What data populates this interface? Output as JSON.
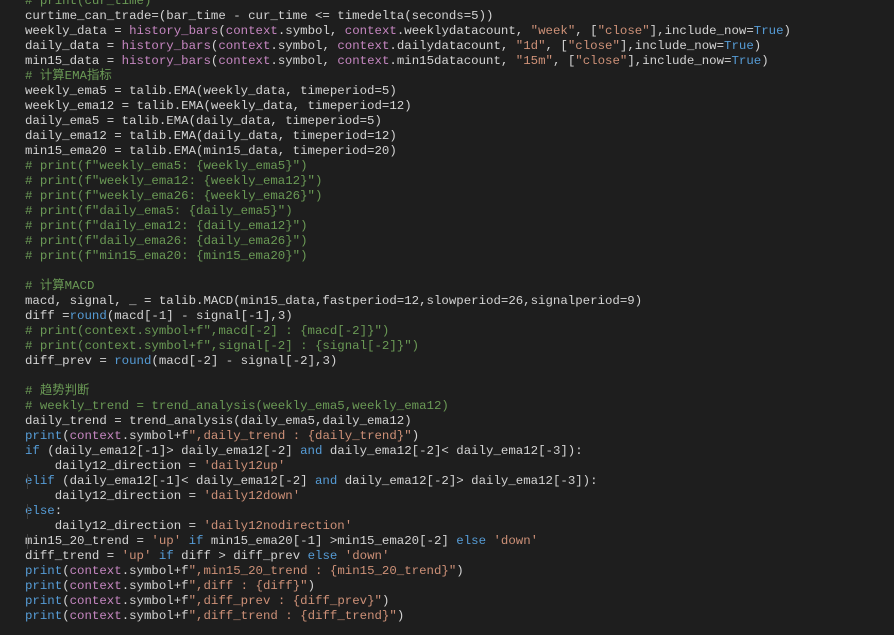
{
  "theme": {
    "background": "#1e1e1e",
    "text": "#d4d4d4",
    "comment": "#6a9955",
    "keyword": "#569cd6",
    "function": "#c586c0",
    "string": "#ce9178"
  },
  "lines": [
    [
      {
        "t": "cmt",
        "v": "# print(cur_time)"
      }
    ],
    [
      {
        "t": "txt",
        "v": "curtime_can_trade=(bar_time - cur_time <= timedelta(seconds=5))"
      }
    ],
    [
      {
        "t": "txt",
        "v": "weekly_data = "
      },
      {
        "t": "fn",
        "v": "history_bars"
      },
      {
        "t": "txt",
        "v": "("
      },
      {
        "t": "fn",
        "v": "context"
      },
      {
        "t": "txt",
        "v": ".symbol, "
      },
      {
        "t": "fn",
        "v": "context"
      },
      {
        "t": "txt",
        "v": ".weeklydatacount, "
      },
      {
        "t": "str",
        "v": "\"week\""
      },
      {
        "t": "txt",
        "v": ", ["
      },
      {
        "t": "str",
        "v": "\"close\""
      },
      {
        "t": "txt",
        "v": "],include_now="
      },
      {
        "t": "kw",
        "v": "True"
      },
      {
        "t": "txt",
        "v": ")"
      }
    ],
    [
      {
        "t": "txt",
        "v": "daily_data = "
      },
      {
        "t": "fn",
        "v": "history_bars"
      },
      {
        "t": "txt",
        "v": "("
      },
      {
        "t": "fn",
        "v": "context"
      },
      {
        "t": "txt",
        "v": ".symbol, "
      },
      {
        "t": "fn",
        "v": "context"
      },
      {
        "t": "txt",
        "v": ".dailydatacount, "
      },
      {
        "t": "str",
        "v": "\"1d\""
      },
      {
        "t": "txt",
        "v": ", ["
      },
      {
        "t": "str",
        "v": "\"close\""
      },
      {
        "t": "txt",
        "v": "],include_now="
      },
      {
        "t": "kw",
        "v": "True"
      },
      {
        "t": "txt",
        "v": ")"
      }
    ],
    [
      {
        "t": "txt",
        "v": "min15_data = "
      },
      {
        "t": "fn",
        "v": "history_bars"
      },
      {
        "t": "txt",
        "v": "("
      },
      {
        "t": "fn",
        "v": "context"
      },
      {
        "t": "txt",
        "v": ".symbol, "
      },
      {
        "t": "fn",
        "v": "context"
      },
      {
        "t": "txt",
        "v": ".min15datacount, "
      },
      {
        "t": "str",
        "v": "\"15m\""
      },
      {
        "t": "txt",
        "v": ", ["
      },
      {
        "t": "str",
        "v": "\"close\""
      },
      {
        "t": "txt",
        "v": "],include_now="
      },
      {
        "t": "kw",
        "v": "True"
      },
      {
        "t": "txt",
        "v": ")"
      }
    ],
    [
      {
        "t": "cmt",
        "v": "# 计算EMA指标"
      }
    ],
    [
      {
        "t": "txt",
        "v": "weekly_ema5 = talib.EMA(weekly_data, timeperiod=5)"
      }
    ],
    [
      {
        "t": "txt",
        "v": "weekly_ema12 = talib.EMA(weekly_data, timeperiod=12)"
      }
    ],
    [
      {
        "t": "txt",
        "v": "daily_ema5 = talib.EMA(daily_data, timeperiod=5)"
      }
    ],
    [
      {
        "t": "txt",
        "v": "daily_ema12 = talib.EMA(daily_data, timeperiod=12)"
      }
    ],
    [
      {
        "t": "txt",
        "v": "min15_ema20 = talib.EMA(min15_data, timeperiod=20)"
      }
    ],
    [
      {
        "t": "cmt",
        "v": "# print(f\"weekly_ema5: {weekly_ema5}\")"
      }
    ],
    [
      {
        "t": "cmt",
        "v": "# print(f\"weekly_ema12: {weekly_ema12}\")"
      }
    ],
    [
      {
        "t": "cmt",
        "v": "# print(f\"weekly_ema26: {weekly_ema26}\")"
      }
    ],
    [
      {
        "t": "cmt",
        "v": "# print(f\"daily_ema5: {daily_ema5}\")"
      }
    ],
    [
      {
        "t": "cmt",
        "v": "# print(f\"daily_ema12: {daily_ema12}\")"
      }
    ],
    [
      {
        "t": "cmt",
        "v": "# print(f\"daily_ema26: {daily_ema26}\")"
      }
    ],
    [
      {
        "t": "cmt",
        "v": "# print(f\"min15_ema20: {min15_ema20}\")"
      }
    ],
    [],
    [
      {
        "t": "cmt",
        "v": "# 计算MACD"
      }
    ],
    [
      {
        "t": "txt",
        "v": "macd, signal, _ = talib.MACD(min15_data,fastperiod=12,slowperiod=26,signalperiod=9)"
      }
    ],
    [
      {
        "t": "txt",
        "v": "diff ="
      },
      {
        "t": "kw",
        "v": "round"
      },
      {
        "t": "txt",
        "v": "(macd[-1] - signal[-1],3)"
      }
    ],
    [
      {
        "t": "cmt",
        "v": "# print(context.symbol+f\",macd[-2] : {macd[-2]}\")"
      }
    ],
    [
      {
        "t": "cmt",
        "v": "# print(context.symbol+f\",signal[-2] : {signal[-2]}\")"
      }
    ],
    [
      {
        "t": "txt",
        "v": "diff_prev = "
      },
      {
        "t": "kw",
        "v": "round"
      },
      {
        "t": "txt",
        "v": "(macd[-2] - signal[-2],3)"
      }
    ],
    [],
    [
      {
        "t": "cmt",
        "v": "# 趋势判断"
      }
    ],
    [
      {
        "t": "cmt",
        "v": "# weekly_trend = trend_analysis(weekly_ema5,weekly_ema12)"
      }
    ],
    [
      {
        "t": "txt",
        "v": "daily_trend = trend_analysis(daily_ema5,daily_ema12)"
      }
    ],
    [
      {
        "t": "kw",
        "v": "print"
      },
      {
        "t": "txt",
        "v": "("
      },
      {
        "t": "fn",
        "v": "context"
      },
      {
        "t": "txt",
        "v": ".symbol+f"
      },
      {
        "t": "str",
        "v": "\",daily_trend : {daily_trend}\""
      },
      {
        "t": "txt",
        "v": ")"
      }
    ],
    [
      {
        "t": "kw",
        "v": "if"
      },
      {
        "t": "txt",
        "v": " (daily_ema12[-1]> daily_ema12[-2] "
      },
      {
        "t": "kw",
        "v": "and"
      },
      {
        "t": "txt",
        "v": " daily_ema12[-2]< daily_ema12[-3]):"
      }
    ],
    [
      {
        "t": "txt",
        "v": "    daily12_direction = "
      },
      {
        "t": "str",
        "v": "'daily12up'"
      }
    ],
    [
      {
        "t": "kw",
        "v": "elif"
      },
      {
        "t": "txt",
        "v": " (daily_ema12[-1]< daily_ema12[-2] "
      },
      {
        "t": "kw",
        "v": "and"
      },
      {
        "t": "txt",
        "v": " daily_ema12[-2]> daily_ema12[-3]):"
      }
    ],
    [
      {
        "t": "txt",
        "v": "    daily12_direction = "
      },
      {
        "t": "str",
        "v": "'daily12down'"
      }
    ],
    [
      {
        "t": "kw",
        "v": "else"
      },
      {
        "t": "txt",
        "v": ":"
      }
    ],
    [
      {
        "t": "txt",
        "v": "    daily12_direction = "
      },
      {
        "t": "str",
        "v": "'daily12nodirection'"
      }
    ],
    [
      {
        "t": "txt",
        "v": "min15_20_trend = "
      },
      {
        "t": "str",
        "v": "'up'"
      },
      {
        "t": "txt",
        "v": " "
      },
      {
        "t": "kw",
        "v": "if"
      },
      {
        "t": "txt",
        "v": " min15_ema20[-1] >min15_ema20[-2] "
      },
      {
        "t": "kw",
        "v": "else"
      },
      {
        "t": "txt",
        "v": " "
      },
      {
        "t": "str",
        "v": "'down'"
      }
    ],
    [
      {
        "t": "txt",
        "v": "diff_trend = "
      },
      {
        "t": "str",
        "v": "'up'"
      },
      {
        "t": "txt",
        "v": " "
      },
      {
        "t": "kw",
        "v": "if"
      },
      {
        "t": "txt",
        "v": " diff > diff_prev "
      },
      {
        "t": "kw",
        "v": "else"
      },
      {
        "t": "txt",
        "v": " "
      },
      {
        "t": "str",
        "v": "'down'"
      }
    ],
    [
      {
        "t": "kw",
        "v": "print"
      },
      {
        "t": "txt",
        "v": "("
      },
      {
        "t": "fn",
        "v": "context"
      },
      {
        "t": "txt",
        "v": ".symbol+f"
      },
      {
        "t": "str",
        "v": "\",min15_20_trend : {min15_20_trend}\""
      },
      {
        "t": "txt",
        "v": ")"
      }
    ],
    [
      {
        "t": "kw",
        "v": "print"
      },
      {
        "t": "txt",
        "v": "("
      },
      {
        "t": "fn",
        "v": "context"
      },
      {
        "t": "txt",
        "v": ".symbol+f"
      },
      {
        "t": "str",
        "v": "\",diff : {diff}\""
      },
      {
        "t": "txt",
        "v": ")"
      }
    ],
    [
      {
        "t": "kw",
        "v": "print"
      },
      {
        "t": "txt",
        "v": "("
      },
      {
        "t": "fn",
        "v": "context"
      },
      {
        "t": "txt",
        "v": ".symbol+f"
      },
      {
        "t": "str",
        "v": "\",diff_prev : {diff_prev}\""
      },
      {
        "t": "txt",
        "v": ")"
      }
    ],
    [
      {
        "t": "kw",
        "v": "print"
      },
      {
        "t": "txt",
        "v": "("
      },
      {
        "t": "fn",
        "v": "context"
      },
      {
        "t": "txt",
        "v": ".symbol+f"
      },
      {
        "t": "str",
        "v": "\",diff_trend : {diff_trend}\""
      },
      {
        "t": "txt",
        "v": ")"
      }
    ]
  ]
}
